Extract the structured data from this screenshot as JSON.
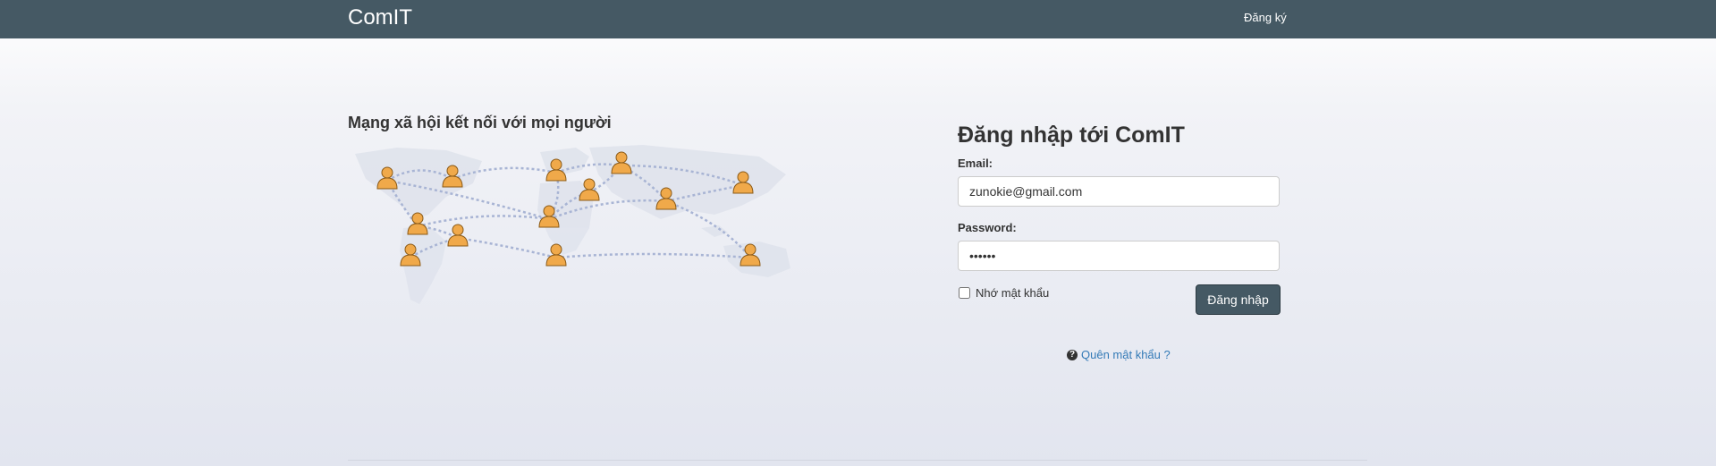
{
  "header": {
    "brand": "ComIT",
    "register_link": "Đăng ký"
  },
  "hero": {
    "tagline": "Mạng xã hội kết nối với mọi người",
    "image_icon": "world-network-illustration"
  },
  "login": {
    "title": "Đăng nhập tới ComIT",
    "email_label": "Email:",
    "email_value": "zunokie@gmail.com",
    "password_label": "Password:",
    "password_value": "123456",
    "remember_label": "Nhớ mật khẩu",
    "remember_checked": false,
    "submit_label": "Đăng nhập",
    "forgot_label": "Quên mật khẩu ?",
    "forgot_icon": "question-circle-icon"
  },
  "colors": {
    "navbar": "#455964",
    "button": "#455964",
    "link": "#337ab7",
    "person_fill": "#f0a94a"
  }
}
